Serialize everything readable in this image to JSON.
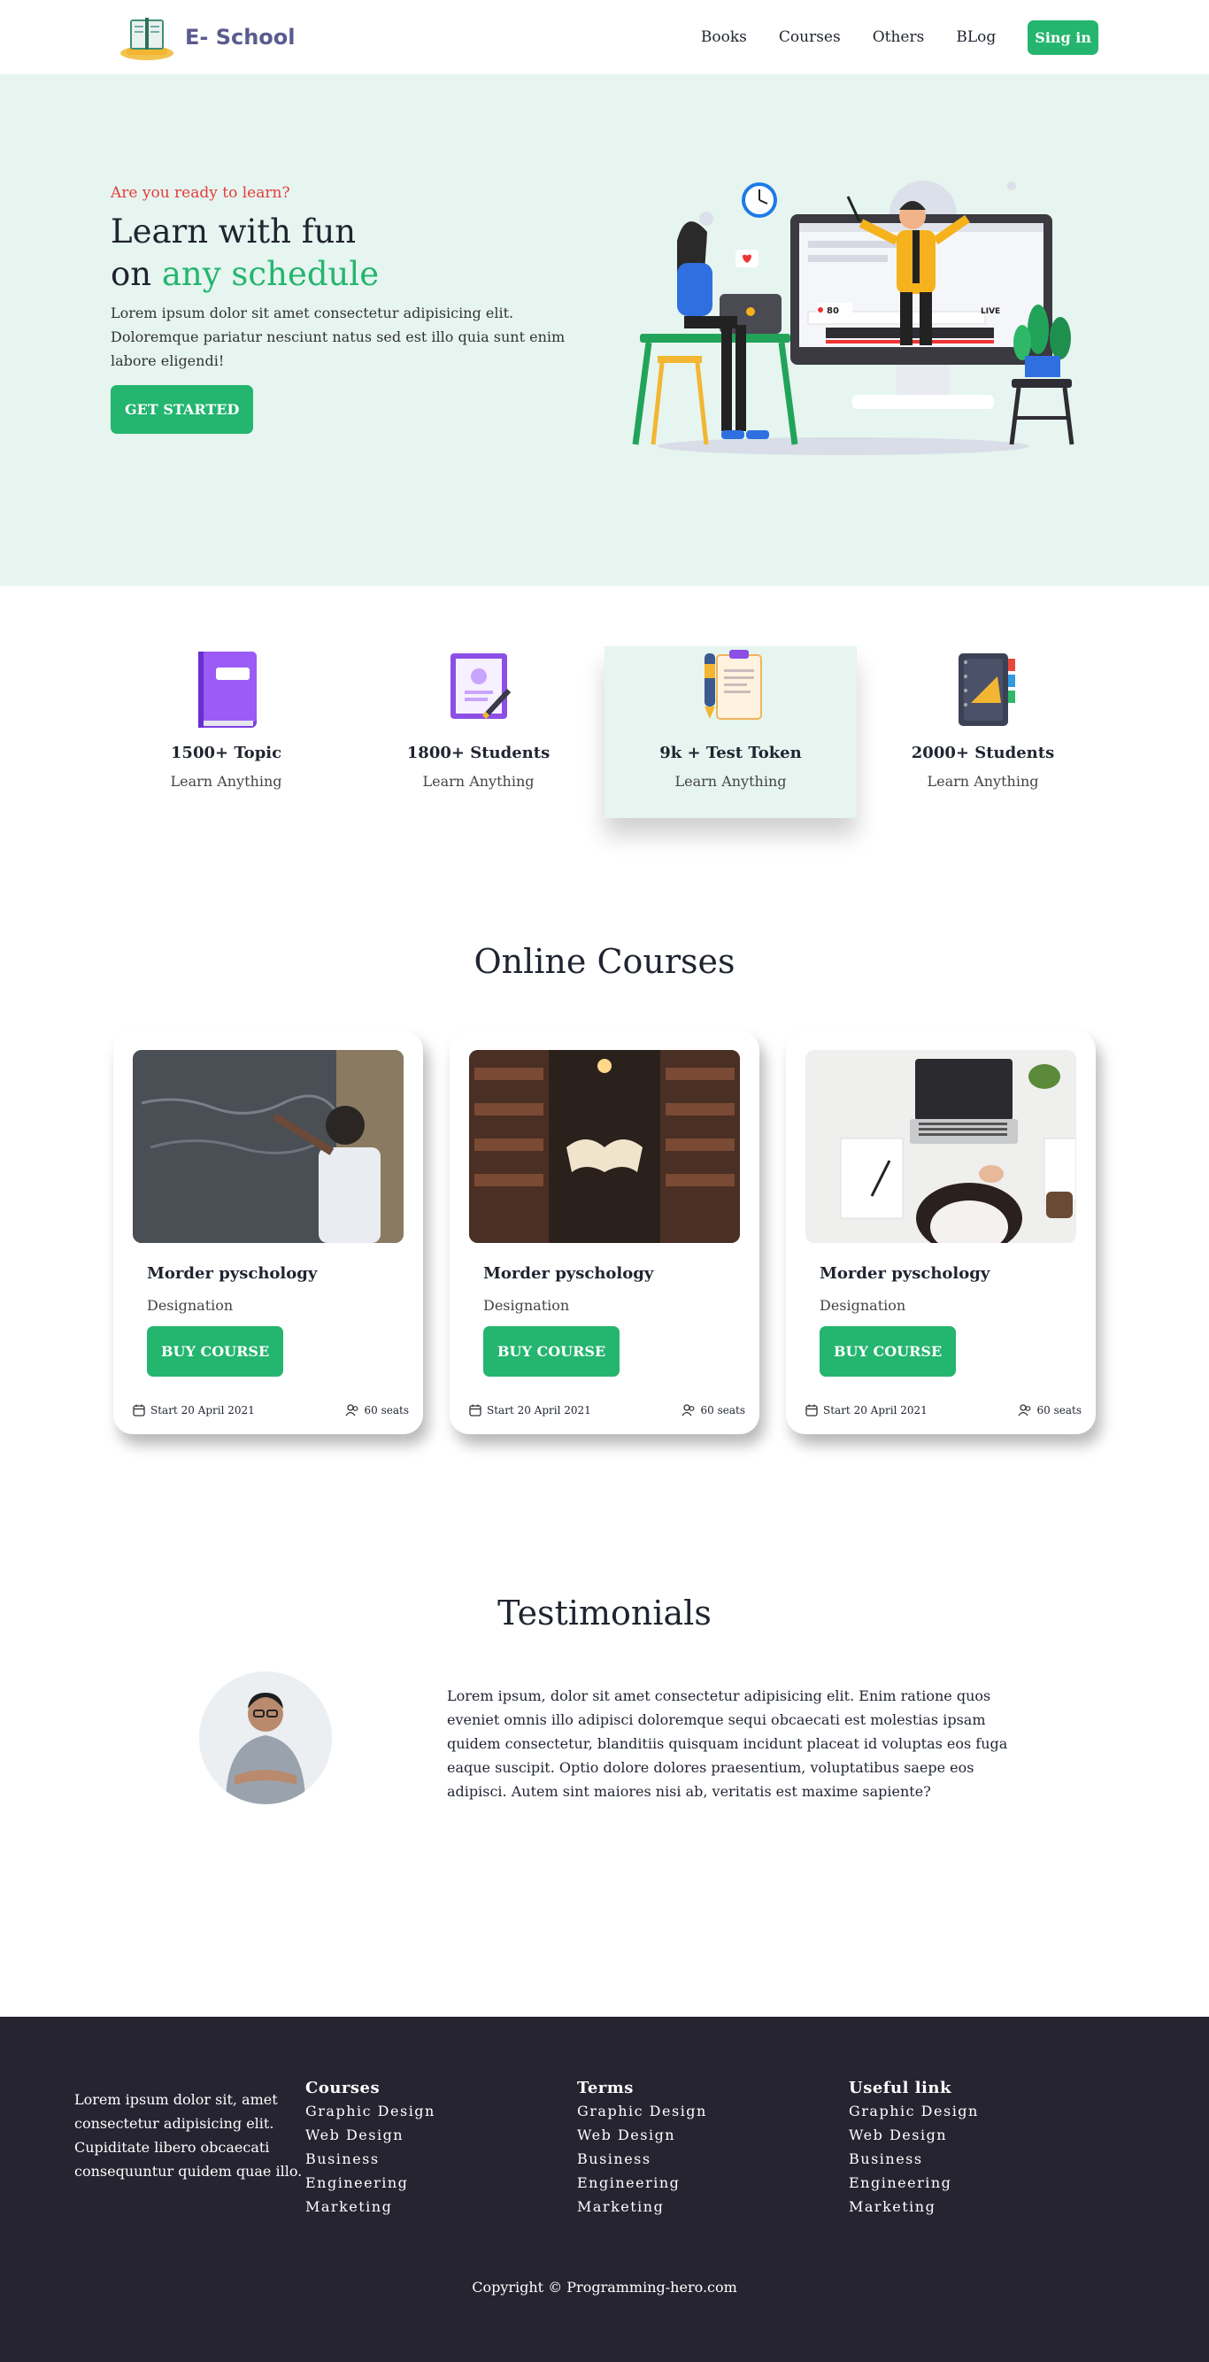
{
  "nav": {
    "brand": "E- School",
    "links": [
      "Books",
      "Courses",
      "Others",
      "BLog"
    ],
    "signin_label": "Sing in"
  },
  "hero": {
    "kicker": "Are you ready to learn?",
    "title_line1": "Learn with fun",
    "title_line2_prefix": "on ",
    "title_line2_accent": "any schedule",
    "description": "Lorem ipsum dolor sit amet consectetur adipisicing elit. Doloremque pariatur nesciunt natus sed est illo quia sunt enim labore eligendi!",
    "cta_label": "GET STARTED",
    "illustration_badges": [
      "80",
      "LIVE"
    ]
  },
  "stats": [
    {
      "title": "1500+ Topic",
      "sub": "Learn Anything",
      "icon": "book-icon"
    },
    {
      "title": "1800+ Students",
      "sub": "Learn Anything",
      "icon": "certificate-icon"
    },
    {
      "title": "9k + Test Token",
      "sub": "Learn Anything",
      "icon": "clipboard-pen-icon"
    },
    {
      "title": "2000+ Students",
      "sub": "Learn Anything",
      "icon": "notebook-icon"
    }
  ],
  "courses": {
    "heading": "Online Courses",
    "items": [
      {
        "title": "Morder pyschology",
        "designation": "Designation",
        "button": "BUY COURSE",
        "start": "Start 20 April 2021",
        "seats": "60 seats",
        "image": "student-at-chalkboard"
      },
      {
        "title": "Morder pyschology",
        "designation": "Designation",
        "button": "BUY COURSE",
        "start": "Start 20 April 2021",
        "seats": "60 seats",
        "image": "library-floating-book"
      },
      {
        "title": "Morder pyschology",
        "designation": "Designation",
        "button": "BUY COURSE",
        "start": "Start 20 April 2021",
        "seats": "60 seats",
        "image": "laptop-desk-workspace"
      }
    ]
  },
  "testimonials": {
    "heading": "Testimonials",
    "quote": "Lorem ipsum, dolor sit amet consectetur adipisicing elit. Enim ratione quos eveniet omnis illo adipisci doloremque sequi obcaecati est molestias ipsam quidem consectetur, blanditiis quisquam incidunt placeat id voluptas eos fuga eaque suscipit. Optio dolore dolores praesentium, voluptatibus saepe eos adipisci. Autem sint maiores nisi ab, veritatis est maxime sapiente?"
  },
  "footer": {
    "about": "Lorem ipsum dolor sit, amet consectetur adipisicing elit. Cupiditate libero obcaecati consequuntur quidem quae illo.",
    "columns": [
      {
        "title": "Courses",
        "links": [
          "Graphic Design",
          "Web Design",
          "Business",
          "Engineering",
          "Marketing"
        ]
      },
      {
        "title": "Terms",
        "links": [
          "Graphic Design",
          "Web Design",
          "Business",
          "Engineering",
          "Marketing"
        ]
      },
      {
        "title": "Useful link",
        "links": [
          "Graphic Design",
          "Web Design",
          "Business",
          "Engineering",
          "Marketing"
        ]
      }
    ],
    "copyright": "Copyright © Programming-hero.com"
  },
  "colors": {
    "accent": "#24b56f",
    "hero_bg": "#e6f5ef",
    "kicker": "#e63b3b",
    "footer_bg": "#262431",
    "brand_text": "#5a5b8f"
  }
}
